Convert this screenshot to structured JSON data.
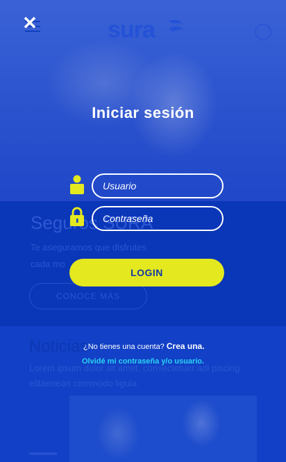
{
  "background": {
    "logo_text": "sura",
    "promo_title": "Seguros SURA",
    "promo_text_1": "Te aseguramos que disfrutes",
    "promo_text_2": "cada mo",
    "promo_button": "CONOCE MÁS",
    "news_title": "Noticias",
    "news_text": "Lorem ipsum dolor sit amet, consectetuer adi piscing elitaenean commodo ligula."
  },
  "login": {
    "close_icon": "close-icon",
    "title": "Iniciar sesión",
    "username_placeholder": "Usuario",
    "password_placeholder": "Contraseña",
    "login_button": "LOGIN",
    "no_account_text": "¿No tienes una cuenta?",
    "create_account_link": "Crea una.",
    "forgot_link": "Olvidé mi contraseña y/o usuario."
  },
  "colors": {
    "overlay_blue": "#0d3ec7",
    "accent_yellow": "#e3e81f",
    "link_cyan": "#2bd4f2"
  }
}
